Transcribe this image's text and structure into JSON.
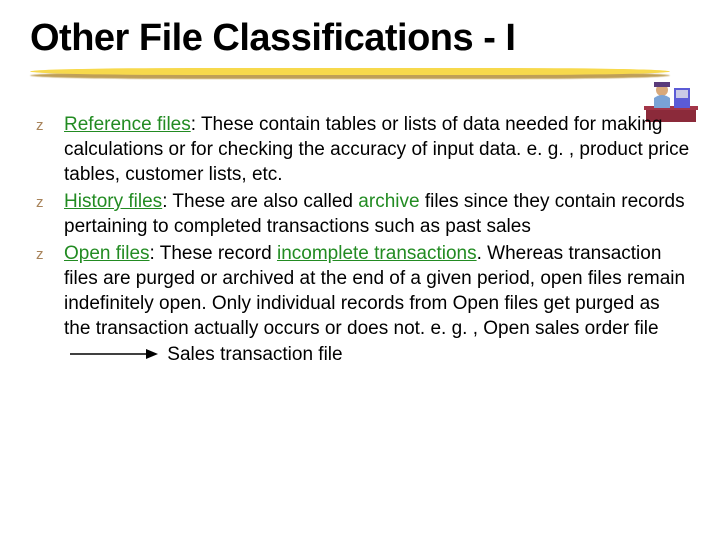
{
  "title": "Other File Classifications - I",
  "bullets": {
    "b1": {
      "term": "Reference files",
      "rest": ": These contain tables or lists of data needed for making calculations or for checking the accuracy of input data. e. g. , product price tables, customer lists, etc."
    },
    "b2": {
      "term": "History files",
      "mid1": ": These are also called ",
      "kw": "archive",
      "mid2": " files since they contain records pertaining to completed transactions such as past sales"
    },
    "b3": {
      "term": "Open files",
      "mid1": ": These record ",
      "kw": "incomplete transactions",
      "mid2": ". Whereas transaction files are purged or archived at the end of a given period, open files remain indefinitely open.  Only individual records from Open files get purged as the transaction actually occurs or does not. e. g. , Open sales order file",
      "tail": "Sales transaction file"
    }
  },
  "icons": {
    "bullet": "z",
    "clipart": "person-at-desk-icon",
    "arrow": "arrow-right-icon"
  }
}
